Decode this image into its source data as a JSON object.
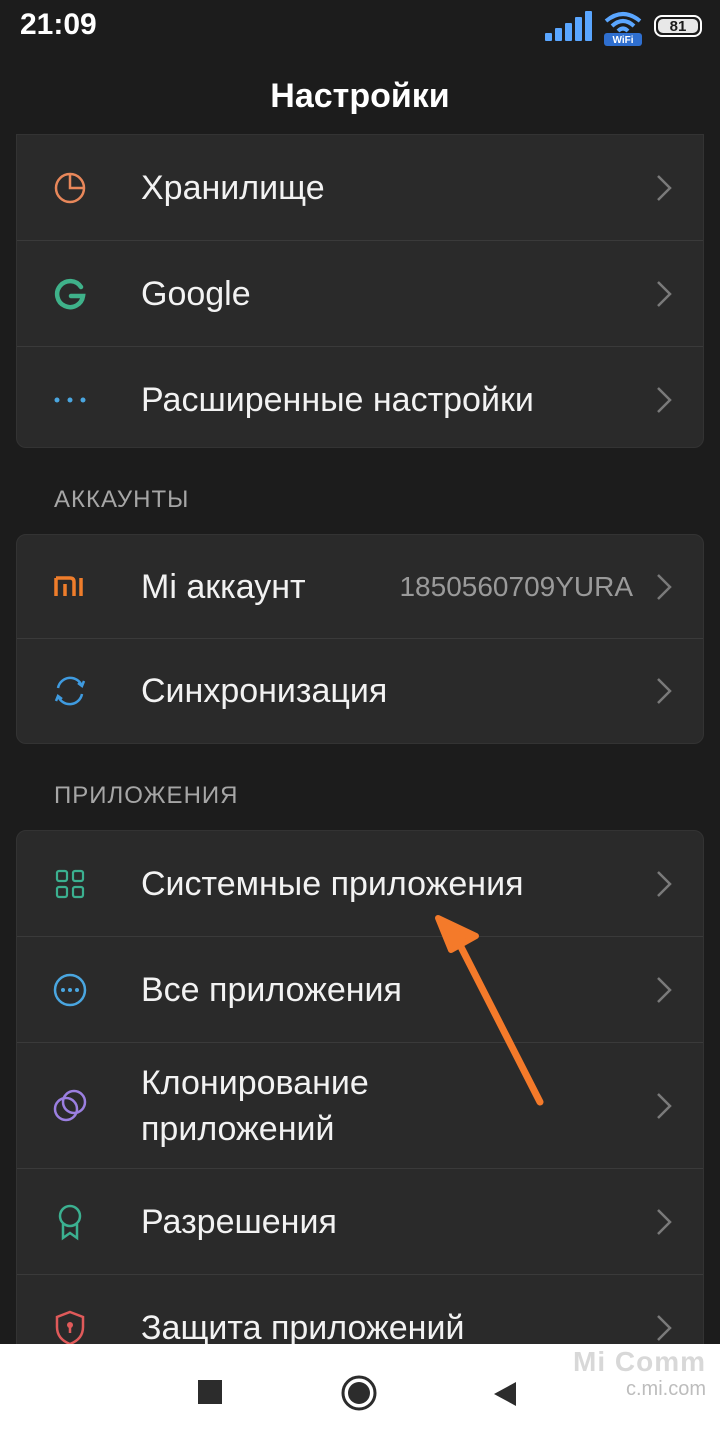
{
  "status": {
    "time": "21:09",
    "battery": "81",
    "wifi_label": "WiFi"
  },
  "header": {
    "title": "Настройки"
  },
  "top_card": [
    {
      "label": "Хранилище",
      "icon": "storage-pie-icon"
    },
    {
      "label": "Google",
      "icon": "google-g-icon"
    },
    {
      "label": "Расширенные настройки",
      "icon": "more-dots-icon"
    }
  ],
  "accounts": {
    "title": "АККАУНТЫ",
    "items": [
      {
        "label": "Mi аккаунт",
        "value": "1850560709YURA",
        "icon": "mi-logo-icon"
      },
      {
        "label": "Синхронизация",
        "icon": "sync-icon"
      }
    ]
  },
  "apps": {
    "title": "ПРИЛОЖЕНИЯ",
    "items": [
      {
        "label": "Системные приложения",
        "icon": "grid-apps-icon"
      },
      {
        "label": "Все приложения",
        "icon": "circle-dots-icon"
      },
      {
        "label": "Клонирование\nприложений",
        "line1": "Клонирование",
        "line2": "приложений",
        "icon": "clone-circles-icon"
      },
      {
        "label": "Разрешения",
        "icon": "badge-ribbon-icon"
      },
      {
        "label": "Защита приложений",
        "icon": "shield-lock-icon"
      }
    ]
  },
  "watermark": {
    "line1": "Mi Comm",
    "line2": "c.mi.com"
  },
  "colors": {
    "storage": "#e8875a",
    "google": "#3fb28a",
    "dots": "#4aa6e0",
    "mi": "#ef7d2b",
    "sync": "#3f9be0",
    "grid": "#3bb090",
    "circle": "#4aa6e0",
    "clone": "#9b7fe0",
    "badge": "#3bb090",
    "shield": "#e05a5a",
    "arrow": "#f47a2a"
  }
}
